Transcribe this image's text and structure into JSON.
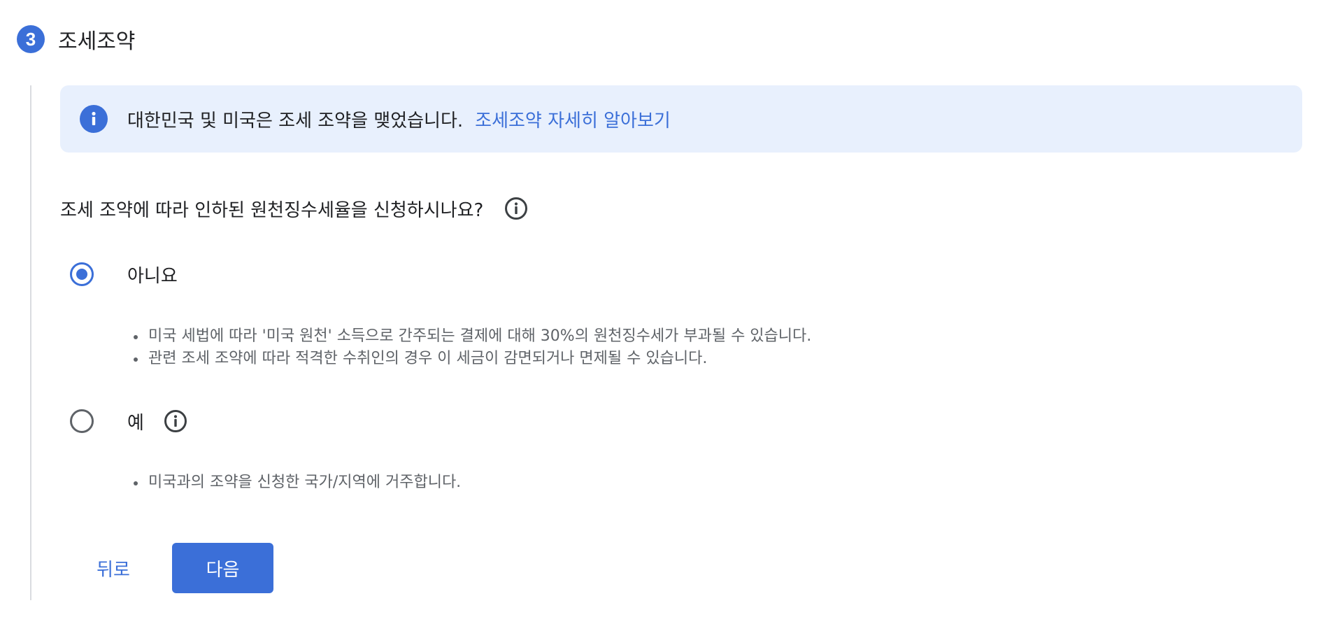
{
  "step": {
    "number": "3",
    "title": "조세조약"
  },
  "banner": {
    "icon": "info-icon",
    "text": "대한민국 및 미국은 조세 조약을 맺었습니다.",
    "link_label": "조세조약 자세히 알아보기"
  },
  "question": {
    "text": "조세 조약에 따라 인하된 원천징수세율을 신청하시나요?",
    "help_icon": "info-outline-icon"
  },
  "options": [
    {
      "label": "아니요",
      "selected": true,
      "bullets": [
        "미국 세법에 따라 '미국 원천' 소득으로 간주되는 결제에 대해 30%의 원천징수세가 부과될 수 있습니다.",
        "관련 조세 조약에 따라 적격한 수취인의 경우 이 세금이 감면되거나 면제될 수 있습니다."
      ]
    },
    {
      "label": "예",
      "selected": false,
      "help_icon": "info-outline-icon",
      "bullets": [
        "미국과의 조약을 신청한 국가/지역에 거주합니다."
      ]
    }
  ],
  "actions": {
    "back_label": "뒤로",
    "next_label": "다음"
  },
  "colors": {
    "accent": "#3b6fd8",
    "banner_bg": "#e8f0fd",
    "text_primary": "#202124",
    "text_secondary": "#5f6368",
    "divider": "#dadce0"
  }
}
